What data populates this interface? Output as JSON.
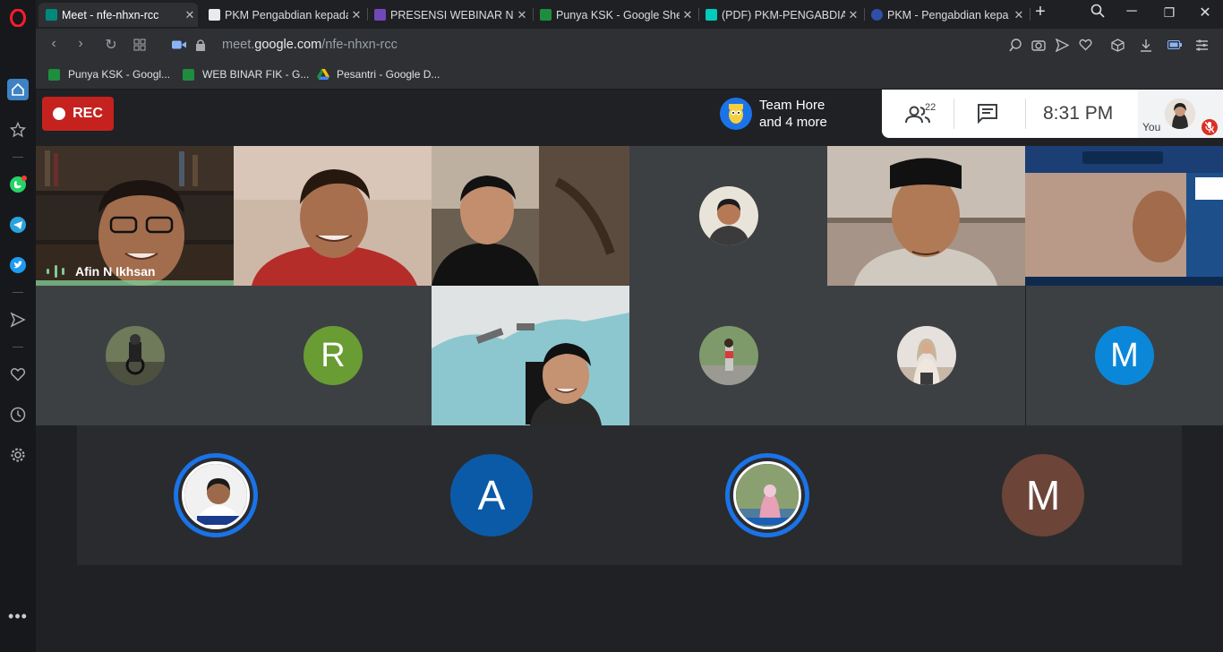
{
  "browser": {
    "tabs": [
      {
        "title": "Meet - nfe-nhxn-rcc",
        "active": true
      },
      {
        "title": "PKM Pengabdian kepada",
        "active": false
      },
      {
        "title": "PRESENSI WEBINAR NGO",
        "active": false
      },
      {
        "title": "Punya KSK - Google She",
        "active": false
      },
      {
        "title": "(PDF) PKM-PENGABDIAN",
        "active": false
      },
      {
        "title": "PKM - Pengabdian kepa",
        "active": false
      }
    ],
    "url_prefix": "meet.",
    "url_domain": "google.com",
    "url_path": "/nfe-nhxn-rcc",
    "bookmarks": [
      {
        "label": "Punya KSK - Googl..."
      },
      {
        "label": "WEB BINAR FIK - G..."
      },
      {
        "label": "Pesantri - Google D..."
      }
    ]
  },
  "meet": {
    "rec_label": "REC",
    "presenter": {
      "line1": "Team Hore",
      "line2": "and 4 more"
    },
    "participant_count": "22",
    "time": "8:31 PM",
    "self_label": "You",
    "speaker_name": "Afin N Ikhsan",
    "tile_letters": {
      "r": "R",
      "m1": "M",
      "a": "A",
      "m2": "M"
    }
  },
  "colors": {
    "accent": "#1a73e8",
    "rec": "#c5221f",
    "speaking": "#81c995",
    "avatar_r": "#6a9c34",
    "avatar_m1": "#0b87d9",
    "avatar_a": "#0b5aa8",
    "avatar_m2": "#6d4438"
  }
}
